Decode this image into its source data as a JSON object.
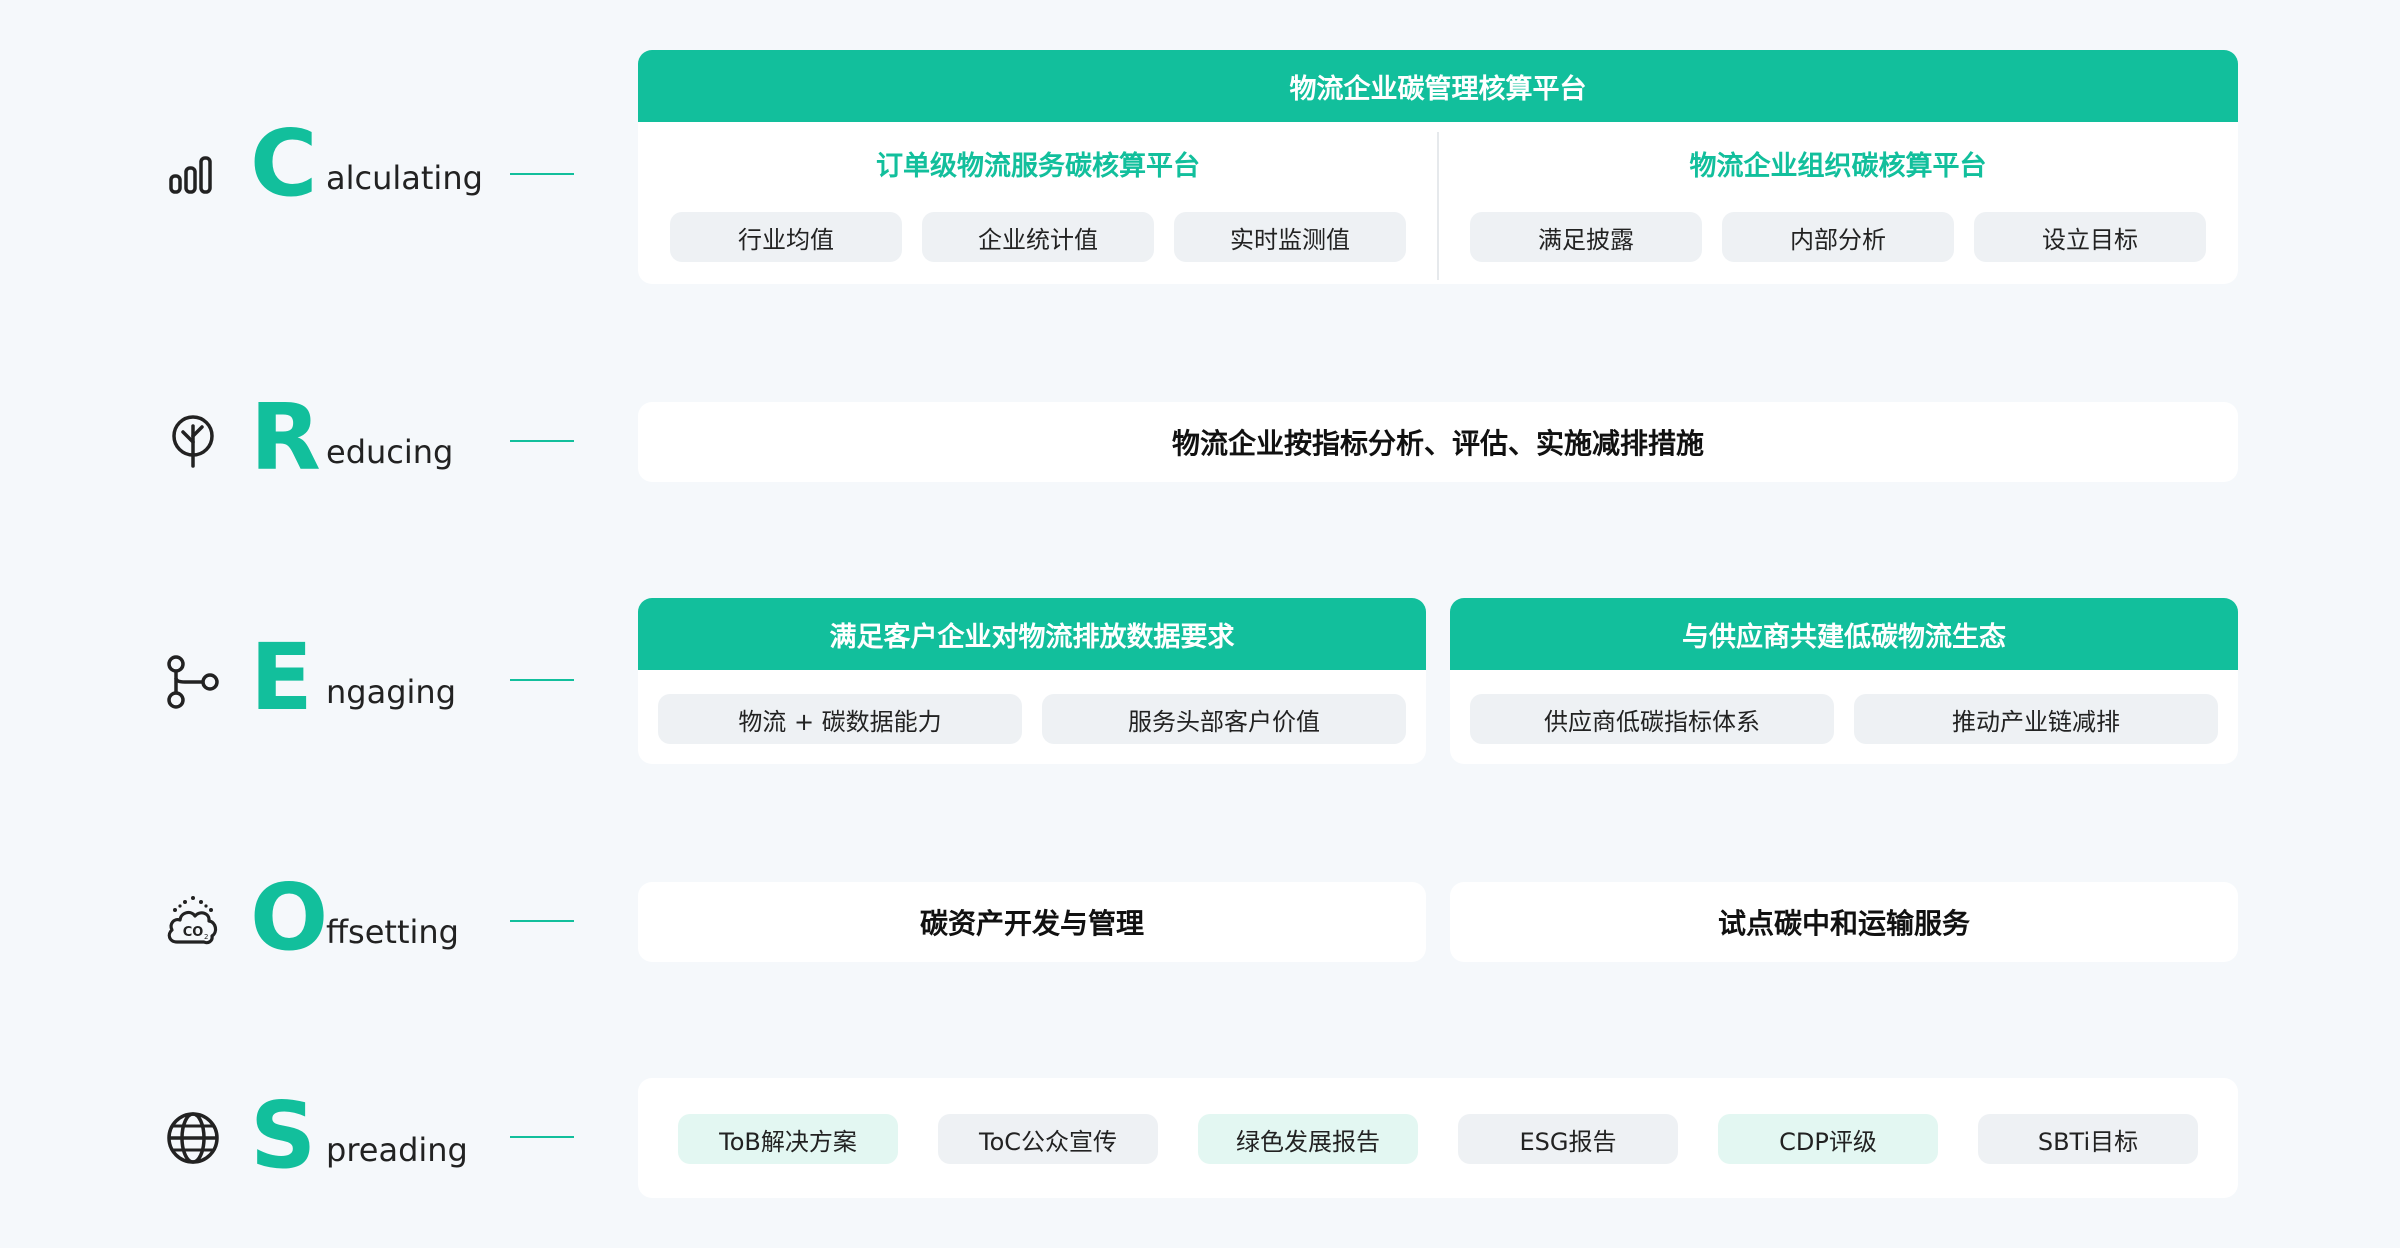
{
  "rows": {
    "calculating": {
      "letter": "C",
      "rest": "alculating",
      "icon": "bar-chart-icon"
    },
    "reducing": {
      "letter": "R",
      "rest": "educing",
      "icon": "tree-icon"
    },
    "engaging": {
      "letter": "E",
      "rest": "ngaging",
      "icon": "network-branch-icon"
    },
    "offsetting": {
      "letter": "O",
      "rest": "ffsetting",
      "icon": "co2-cloud-icon"
    },
    "spreading": {
      "letter": "S",
      "rest": "preading",
      "icon": "globe-icon"
    }
  },
  "calculating_panel": {
    "header": "物流企业碳管理核算平台",
    "left": {
      "title": "订单级物流服务碳核算平台",
      "pills": [
        "行业均值",
        "企业统计值",
        "实时监测值"
      ]
    },
    "right": {
      "title": "物流企业组织碳核算平台",
      "pills": [
        "满足披露",
        "内部分析",
        "设立目标"
      ]
    }
  },
  "reducing_panel": {
    "text": "物流企业按指标分析、评估、实施减排措施"
  },
  "engaging_panels": {
    "left": {
      "header": "满足客户企业对物流排放数据要求",
      "pills": [
        "物流 + 碳数据能力",
        "服务头部客户价值"
      ]
    },
    "right": {
      "header": "与供应商共建低碳物流生态",
      "pills": [
        "供应商低碳指标体系",
        "推动产业链减排"
      ]
    }
  },
  "offsetting_panels": {
    "left": "碳资产开发与管理",
    "right": "试点碳中和运输服务"
  },
  "spreading_panel": {
    "pills": [
      "ToB解决方案",
      "ToC公众宣传",
      "绿色发展报告",
      "ESG报告",
      "CDP评级",
      "SBTi目标"
    ]
  },
  "colors": {
    "accent": "#12bf9c",
    "pill_bg": "#eef1f4",
    "pill_teal_bg": "#e3f7f2",
    "page_bg": "#f5f8fb"
  }
}
